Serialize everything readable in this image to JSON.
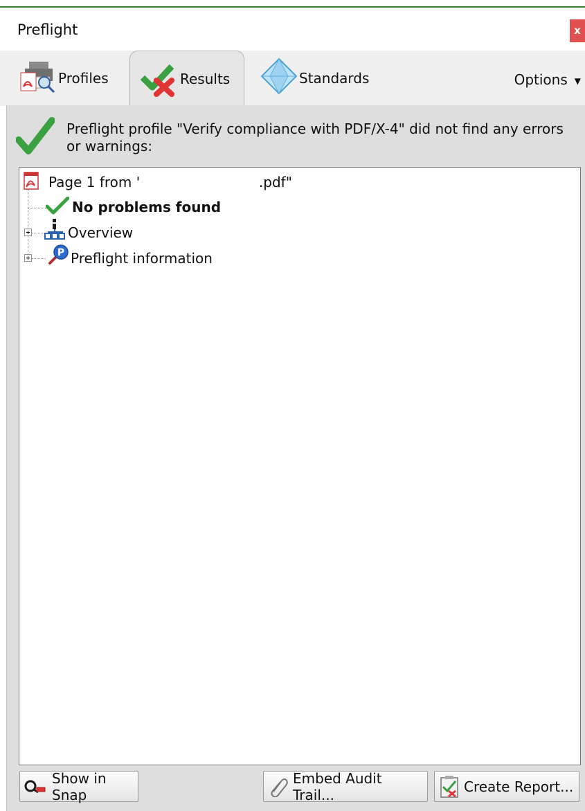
{
  "window": {
    "title": "Preflight",
    "close_label": "x"
  },
  "tabs": [
    {
      "label": "Profiles",
      "icon": "profiles-icon",
      "active": false
    },
    {
      "label": "Results",
      "icon": "results-icon",
      "active": true
    },
    {
      "label": "Standards",
      "icon": "standards-icon",
      "active": false
    }
  ],
  "options_label": "Options",
  "summary": {
    "message": "Preflight profile \"Verify compliance with PDF/X-4\" did not find any errors or warnings:"
  },
  "tree": {
    "page_label": "Page 1 from '                           .pdf\"",
    "status_label": "No problems found",
    "overview_label": "Overview",
    "preflight_info_label": "Preflight information"
  },
  "buttons": {
    "show_in_snap": "Show in Snap",
    "embed_audit_trail": "Embed Audit Trail...",
    "create_report": "Create Report..."
  },
  "colors": {
    "accent_green": "#3aa040",
    "red_x": "#e03535",
    "close_red": "#e05050"
  }
}
